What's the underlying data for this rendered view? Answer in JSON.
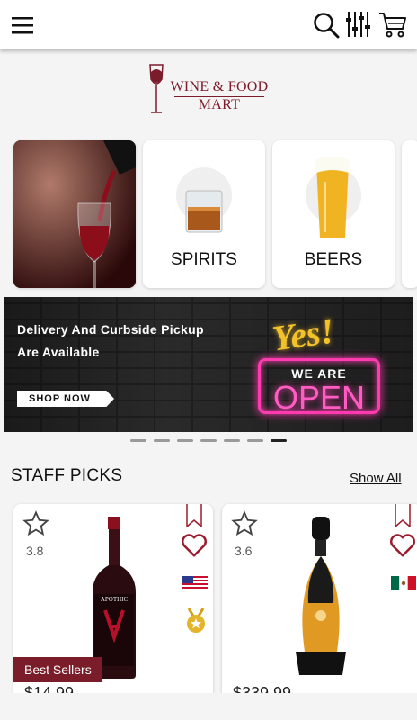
{
  "header": {
    "menu_icon": "hamburger-menu-icon",
    "search_icon": "search-icon",
    "filter_icon": "filter-sliders-icon",
    "cart_icon": "shopping-cart-icon"
  },
  "logo": {
    "line1": "WINE & FOOD",
    "line2": "MART",
    "brand_color": "#7b1c2a"
  },
  "categories": [
    {
      "label": ""
    },
    {
      "label": "SPIRITS"
    },
    {
      "label": "BEERS"
    }
  ],
  "banner": {
    "line1": "Delivery And Curbside Pickup",
    "line2": "Are Available",
    "cta": "SHOP NOW",
    "yes": "Yes!",
    "we_are": "WE ARE",
    "open": "OPEN"
  },
  "carousel": {
    "total": 7,
    "active": 7
  },
  "staff_picks": {
    "title": "STAFF PICKS",
    "show_all": "Show All"
  },
  "products": [
    {
      "rating": "3.8",
      "badge": "Best Sellers",
      "price": "$14.99",
      "flag": "usa-flag-icon",
      "award": "medal-icon",
      "bottle_label": "APOTHIC"
    },
    {
      "rating": "3.6",
      "price": "$339.99",
      "flag": "mexico-flag-icon"
    }
  ],
  "colors": {
    "accent": "#7b1c2a",
    "neon_pink": "#ff3bb0",
    "neon_yellow": "#f3c22a"
  }
}
